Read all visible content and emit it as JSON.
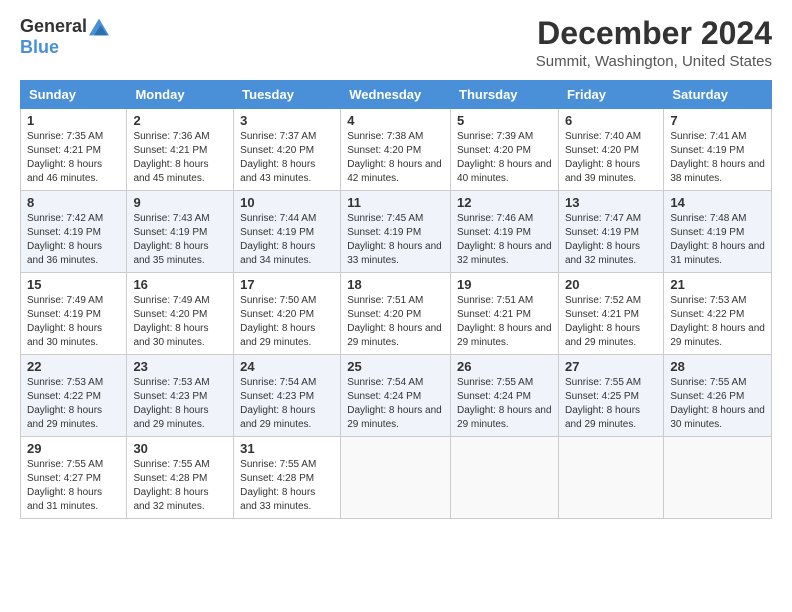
{
  "logo": {
    "general": "General",
    "blue": "Blue"
  },
  "title": "December 2024",
  "location": "Summit, Washington, United States",
  "headers": [
    "Sunday",
    "Monday",
    "Tuesday",
    "Wednesday",
    "Thursday",
    "Friday",
    "Saturday"
  ],
  "weeks": [
    [
      {
        "day": "1",
        "sunrise": "7:35 AM",
        "sunset": "4:21 PM",
        "daylight": "8 hours and 46 minutes."
      },
      {
        "day": "2",
        "sunrise": "7:36 AM",
        "sunset": "4:21 PM",
        "daylight": "8 hours and 45 minutes."
      },
      {
        "day": "3",
        "sunrise": "7:37 AM",
        "sunset": "4:20 PM",
        "daylight": "8 hours and 43 minutes."
      },
      {
        "day": "4",
        "sunrise": "7:38 AM",
        "sunset": "4:20 PM",
        "daylight": "8 hours and 42 minutes."
      },
      {
        "day": "5",
        "sunrise": "7:39 AM",
        "sunset": "4:20 PM",
        "daylight": "8 hours and 40 minutes."
      },
      {
        "day": "6",
        "sunrise": "7:40 AM",
        "sunset": "4:20 PM",
        "daylight": "8 hours and 39 minutes."
      },
      {
        "day": "7",
        "sunrise": "7:41 AM",
        "sunset": "4:19 PM",
        "daylight": "8 hours and 38 minutes."
      }
    ],
    [
      {
        "day": "8",
        "sunrise": "7:42 AM",
        "sunset": "4:19 PM",
        "daylight": "8 hours and 36 minutes."
      },
      {
        "day": "9",
        "sunrise": "7:43 AM",
        "sunset": "4:19 PM",
        "daylight": "8 hours and 35 minutes."
      },
      {
        "day": "10",
        "sunrise": "7:44 AM",
        "sunset": "4:19 PM",
        "daylight": "8 hours and 34 minutes."
      },
      {
        "day": "11",
        "sunrise": "7:45 AM",
        "sunset": "4:19 PM",
        "daylight": "8 hours and 33 minutes."
      },
      {
        "day": "12",
        "sunrise": "7:46 AM",
        "sunset": "4:19 PM",
        "daylight": "8 hours and 32 minutes."
      },
      {
        "day": "13",
        "sunrise": "7:47 AM",
        "sunset": "4:19 PM",
        "daylight": "8 hours and 32 minutes."
      },
      {
        "day": "14",
        "sunrise": "7:48 AM",
        "sunset": "4:19 PM",
        "daylight": "8 hours and 31 minutes."
      }
    ],
    [
      {
        "day": "15",
        "sunrise": "7:49 AM",
        "sunset": "4:19 PM",
        "daylight": "8 hours and 30 minutes."
      },
      {
        "day": "16",
        "sunrise": "7:49 AM",
        "sunset": "4:20 PM",
        "daylight": "8 hours and 30 minutes."
      },
      {
        "day": "17",
        "sunrise": "7:50 AM",
        "sunset": "4:20 PM",
        "daylight": "8 hours and 29 minutes."
      },
      {
        "day": "18",
        "sunrise": "7:51 AM",
        "sunset": "4:20 PM",
        "daylight": "8 hours and 29 minutes."
      },
      {
        "day": "19",
        "sunrise": "7:51 AM",
        "sunset": "4:21 PM",
        "daylight": "8 hours and 29 minutes."
      },
      {
        "day": "20",
        "sunrise": "7:52 AM",
        "sunset": "4:21 PM",
        "daylight": "8 hours and 29 minutes."
      },
      {
        "day": "21",
        "sunrise": "7:53 AM",
        "sunset": "4:22 PM",
        "daylight": "8 hours and 29 minutes."
      }
    ],
    [
      {
        "day": "22",
        "sunrise": "7:53 AM",
        "sunset": "4:22 PM",
        "daylight": "8 hours and 29 minutes."
      },
      {
        "day": "23",
        "sunrise": "7:53 AM",
        "sunset": "4:23 PM",
        "daylight": "8 hours and 29 minutes."
      },
      {
        "day": "24",
        "sunrise": "7:54 AM",
        "sunset": "4:23 PM",
        "daylight": "8 hours and 29 minutes."
      },
      {
        "day": "25",
        "sunrise": "7:54 AM",
        "sunset": "4:24 PM",
        "daylight": "8 hours and 29 minutes."
      },
      {
        "day": "26",
        "sunrise": "7:55 AM",
        "sunset": "4:24 PM",
        "daylight": "8 hours and 29 minutes."
      },
      {
        "day": "27",
        "sunrise": "7:55 AM",
        "sunset": "4:25 PM",
        "daylight": "8 hours and 29 minutes."
      },
      {
        "day": "28",
        "sunrise": "7:55 AM",
        "sunset": "4:26 PM",
        "daylight": "8 hours and 30 minutes."
      }
    ],
    [
      {
        "day": "29",
        "sunrise": "7:55 AM",
        "sunset": "4:27 PM",
        "daylight": "8 hours and 31 minutes."
      },
      {
        "day": "30",
        "sunrise": "7:55 AM",
        "sunset": "4:28 PM",
        "daylight": "8 hours and 32 minutes."
      },
      {
        "day": "31",
        "sunrise": "7:55 AM",
        "sunset": "4:28 PM",
        "daylight": "8 hours and 33 minutes."
      },
      null,
      null,
      null,
      null
    ]
  ]
}
